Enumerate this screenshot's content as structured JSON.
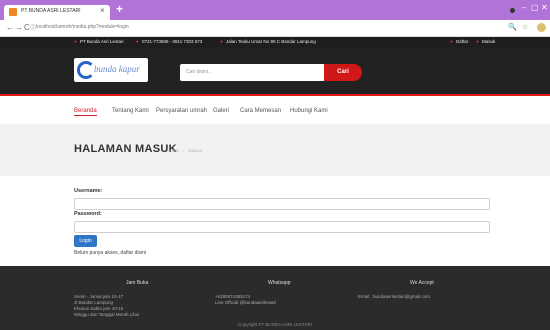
{
  "browser": {
    "tab_title": "PT BUNDA ASRI LESTARI",
    "tab_close": "×",
    "new_tab": "+",
    "url": "localhost/umroh/media.php?module=login",
    "back": "←",
    "forward": "→",
    "reload": "C",
    "info": "ⓘ",
    "zoom": "🔍",
    "star": "☆",
    "win_min": "–",
    "win_max": "▢",
    "win_close": "✕"
  },
  "topbar": {
    "company": "PT Bunda Asri Lestari",
    "phone": "0721-773605 - 0811 7303 673",
    "address": "Jalan Teuku Umar No 90 C Bandar Lampung",
    "daftar": "Daftar",
    "masuk": "Masuk"
  },
  "header": {
    "logo_text": "bunda kapur",
    "search_placeholder": "Cari disini..",
    "search_button": "Cari"
  },
  "nav": {
    "items": [
      "Beranda",
      "Tentang Kami",
      "Persyaratan umrah",
      "Galeri",
      "Cara Memesan",
      "Hubungi Kami"
    ]
  },
  "page": {
    "title": "HALAMAN MASUK",
    "crumb_home": "HOME",
    "crumb_sep": "/",
    "crumb_current": "MASUK"
  },
  "form": {
    "username_label": "Username:",
    "password_label": "Password:",
    "login_button": "Login",
    "register_note": "Belum punya akses, daftar disini"
  },
  "footer": {
    "jam_heading": "Jam Buka",
    "jam_lines": [
      "Senin - Jumat jam 10-17",
      "Jl Bandar Lampung",
      "Khusus Sabtu jam 10-15",
      "Minggu dan Tanggal Merah Libur"
    ],
    "wa_heading": "Whatsapp",
    "wa_lines": [
      "+6285574385174",
      "Line Official @bundaasrilestari"
    ],
    "accept_heading": "We Accept",
    "email": "Email : bundaasrilestari@gmail.com",
    "copyright": "Copyright PT BUNDA ASRI LESTARI"
  },
  "colors": {
    "tabbar": "#b173d8",
    "accent_red": "#d01818",
    "header_dark": "#222222",
    "login_blue": "#2f76c6"
  }
}
